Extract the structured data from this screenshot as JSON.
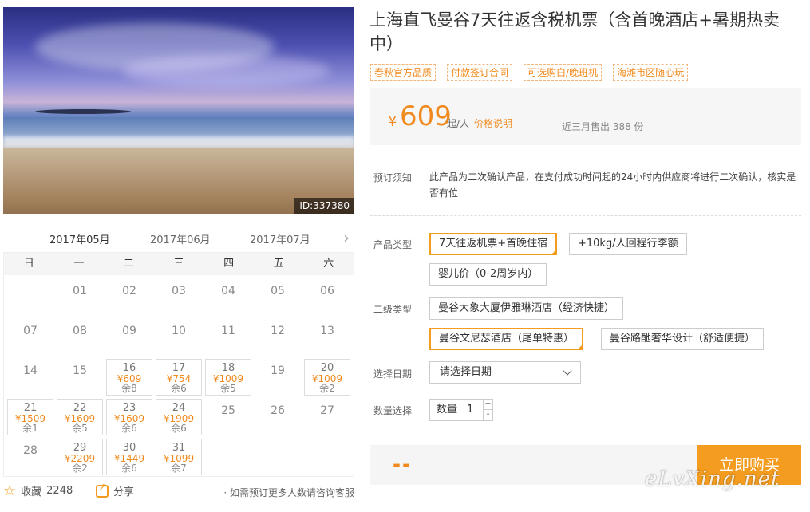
{
  "hero": {
    "id_label": "ID:337380"
  },
  "calendar": {
    "tabs": [
      "2017年05月",
      "2017年06月",
      "2017年07月"
    ],
    "next_icon": "chevron-right-icon",
    "weekdays": [
      "日",
      "一",
      "二",
      "三",
      "四",
      "五",
      "六"
    ],
    "days": [
      {
        "d": "01"
      },
      {
        "d": "02"
      },
      {
        "d": "03"
      },
      {
        "d": "04"
      },
      {
        "d": "05"
      },
      {
        "d": "06"
      },
      {
        "d": "07"
      },
      {
        "d": "08"
      },
      {
        "d": "09"
      },
      {
        "d": "10"
      },
      {
        "d": "11"
      },
      {
        "d": "12"
      },
      {
        "d": "13"
      },
      {
        "d": "14"
      },
      {
        "d": "15"
      },
      {
        "d": "16",
        "price": "¥609",
        "stock": "余8"
      },
      {
        "d": "17",
        "price": "¥754",
        "stock": "余6"
      },
      {
        "d": "18",
        "price": "¥1009",
        "stock": "余5"
      },
      {
        "d": "19"
      },
      {
        "d": "20",
        "price": "¥1009",
        "stock": "余2"
      },
      {
        "d": "21",
        "price": "¥1509",
        "stock": "余1"
      },
      {
        "d": "22",
        "price": "¥1609",
        "stock": "余5"
      },
      {
        "d": "23",
        "price": "¥1609",
        "stock": "余6"
      },
      {
        "d": "24",
        "price": "¥1909",
        "stock": "余6"
      },
      {
        "d": "25"
      },
      {
        "d": "26"
      },
      {
        "d": "27"
      },
      {
        "d": "28"
      },
      {
        "d": "29",
        "price": "¥2209",
        "stock": "余2"
      },
      {
        "d": "30",
        "price": "¥1449",
        "stock": "余6"
      },
      {
        "d": "31",
        "price": "¥1099",
        "stock": "余7"
      }
    ]
  },
  "footer_left": {
    "fav_label": "收藏",
    "fav_count": "2248",
    "share_label": "分享",
    "consult": "· 如需预订更多人数请咨询客服"
  },
  "product": {
    "title": "上海直飞曼谷7天往返含税机票（含首晚酒店+暑期热卖中）",
    "tags": [
      "春秋官方品质",
      "付款签订合同",
      "可选购白/晚班机",
      "海滩市区随心玩"
    ],
    "price": {
      "yen": "¥",
      "value": "609",
      "unit": "起/人",
      "explain": "价格说明",
      "sold": "近三月售出 388 份"
    },
    "notice_label": "预订须知",
    "notice_text": "此产品为二次确认产品，在支付成功时间起的24小时内供应商将进行二次确认，核实是否有位",
    "type_label": "产品类型",
    "types": [
      "7天往返机票+首晚住宿",
      "+10kg/人回程行李额",
      "婴儿价（0-2周岁内）"
    ],
    "subtype_label": "二级类型",
    "subtypes": [
      "曼谷大象大厦伊雅琳酒店（经济快捷）",
      "曼谷文尼瑟酒店（尾单特惠）",
      "曼谷路酏奢华设计（舒适便捷）"
    ],
    "date_label": "选择日期",
    "date_placeholder": "请选择日期",
    "qty_label": "数量选择",
    "qty_inner_label": "数量",
    "qty_value": "1",
    "qty_plus": "+",
    "qty_minus": "-",
    "total_placeholder": "--",
    "buy_label": "立即购买"
  },
  "watermark": "eLvXing.net",
  "colors": {
    "accent": "#f39c1f",
    "price": "#f08a1e"
  }
}
